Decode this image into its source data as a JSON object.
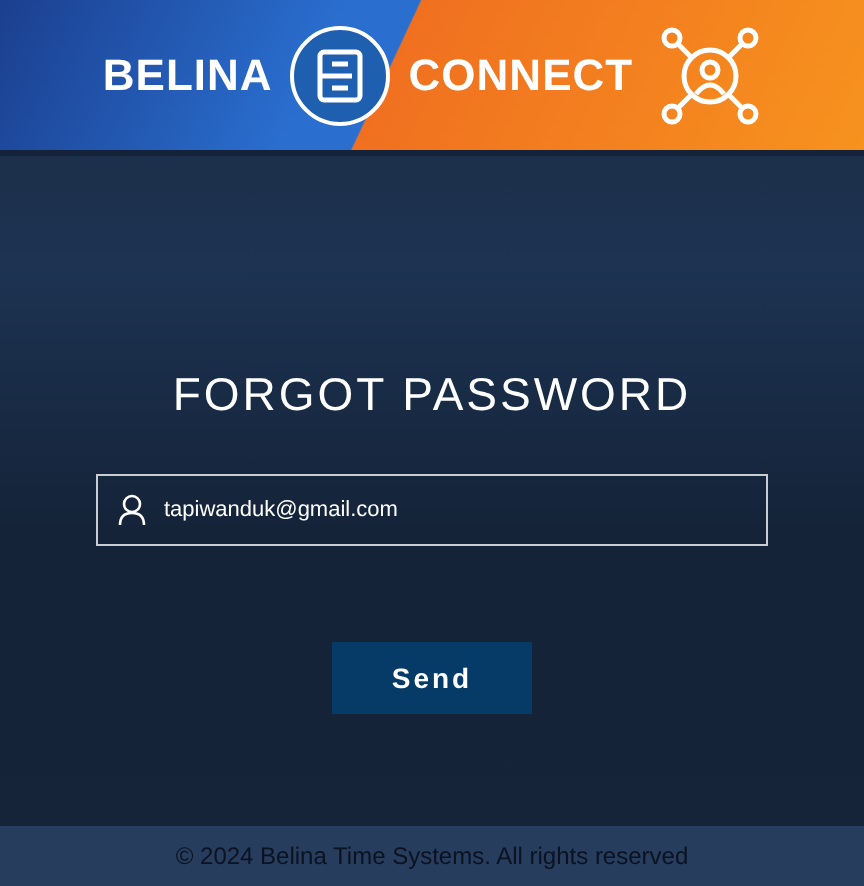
{
  "banner": {
    "brand_left": "BELINA",
    "brand_right": "CONNECT"
  },
  "form": {
    "title": "FORGOT PASSWORD",
    "email": {
      "value": "tapiwanduk@gmail.com"
    },
    "button": "Send"
  },
  "footer": {
    "text": "© 2024 Belina Time Systems. All rights reserved"
  }
}
